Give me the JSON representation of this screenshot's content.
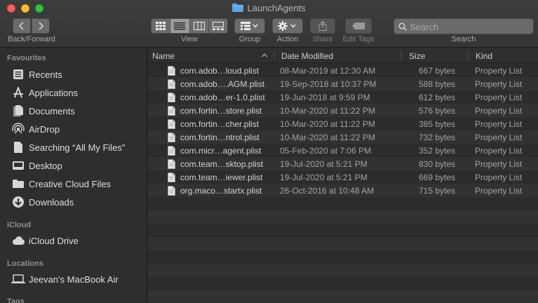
{
  "window": {
    "title": "LaunchAgents"
  },
  "toolbar": {
    "back_forward_label": "Back/Forward",
    "view_label": "View",
    "group_label": "Group",
    "action_label": "Action",
    "share_label": "Share",
    "edit_tags_label": "Edit Tags",
    "search_label": "Search",
    "search_placeholder": "Search"
  },
  "sidebar": {
    "favourites_header": "Favourites",
    "favourites": [
      {
        "label": "Recents",
        "icon": "recents-icon"
      },
      {
        "label": "Applications",
        "icon": "applications-icon"
      },
      {
        "label": "Documents",
        "icon": "documents-icon"
      },
      {
        "label": "AirDrop",
        "icon": "airdrop-icon"
      },
      {
        "label": "Searching “All My Files”",
        "icon": "smart-folder-icon"
      },
      {
        "label": "Desktop",
        "icon": "desktop-icon"
      },
      {
        "label": "Creative Cloud Files",
        "icon": "folder-icon"
      },
      {
        "label": "Downloads",
        "icon": "downloads-icon"
      }
    ],
    "icloud_header": "iCloud",
    "icloud": [
      {
        "label": "iCloud Drive",
        "icon": "cloud-icon"
      }
    ],
    "locations_header": "Locations",
    "locations": [
      {
        "label": "Jeevan’s MacBook Air",
        "icon": "laptop-icon"
      }
    ],
    "tags_header": "Tags"
  },
  "columns": {
    "name": "Name",
    "date": "Date Modified",
    "size": "Size",
    "kind": "Kind"
  },
  "files": [
    {
      "name": "com.adob…loud.plist",
      "date": "08-Mar-2019 at 12:30 AM",
      "size": "667 bytes",
      "kind": "Property List"
    },
    {
      "name": "com.adob….AGM.plist",
      "date": "19-Sep-2018 at 10:37 PM",
      "size": "588 bytes",
      "kind": "Property List"
    },
    {
      "name": "com.adob…er-1.0.plist",
      "date": "19-Jun-2018 at 9:59 PM",
      "size": "612 bytes",
      "kind": "Property List"
    },
    {
      "name": "com.fortin…store.plist",
      "date": "10-Mar-2020 at 11:22 PM",
      "size": "576 bytes",
      "kind": "Property List"
    },
    {
      "name": "com.fortin…cher.plist",
      "date": "10-Mar-2020 at 11:22 PM",
      "size": "385 bytes",
      "kind": "Property List"
    },
    {
      "name": "com.fortin…ntrol.plist",
      "date": "10-Mar-2020 at 11:22 PM",
      "size": "732 bytes",
      "kind": "Property List"
    },
    {
      "name": "com.micr…agent.plist",
      "date": "05-Feb-2020 at 7:06 PM",
      "size": "352 bytes",
      "kind": "Property List"
    },
    {
      "name": "com.team…sktop.plist",
      "date": "19-Jul-2020 at 5:21 PM",
      "size": "830 bytes",
      "kind": "Property List"
    },
    {
      "name": "com.team…iewer.plist",
      "date": "19-Jul-2020 at 5:21 PM",
      "size": "669 bytes",
      "kind": "Property List"
    },
    {
      "name": "org.maco…startx.plist",
      "date": "26-Oct-2016 at 10:48 AM",
      "size": "715 bytes",
      "kind": "Property List"
    }
  ],
  "colors": {
    "accent_folder": "#5aa7e6",
    "sidebar_bg": "#2e2e2e",
    "list_bg": "#2b2b2b"
  }
}
